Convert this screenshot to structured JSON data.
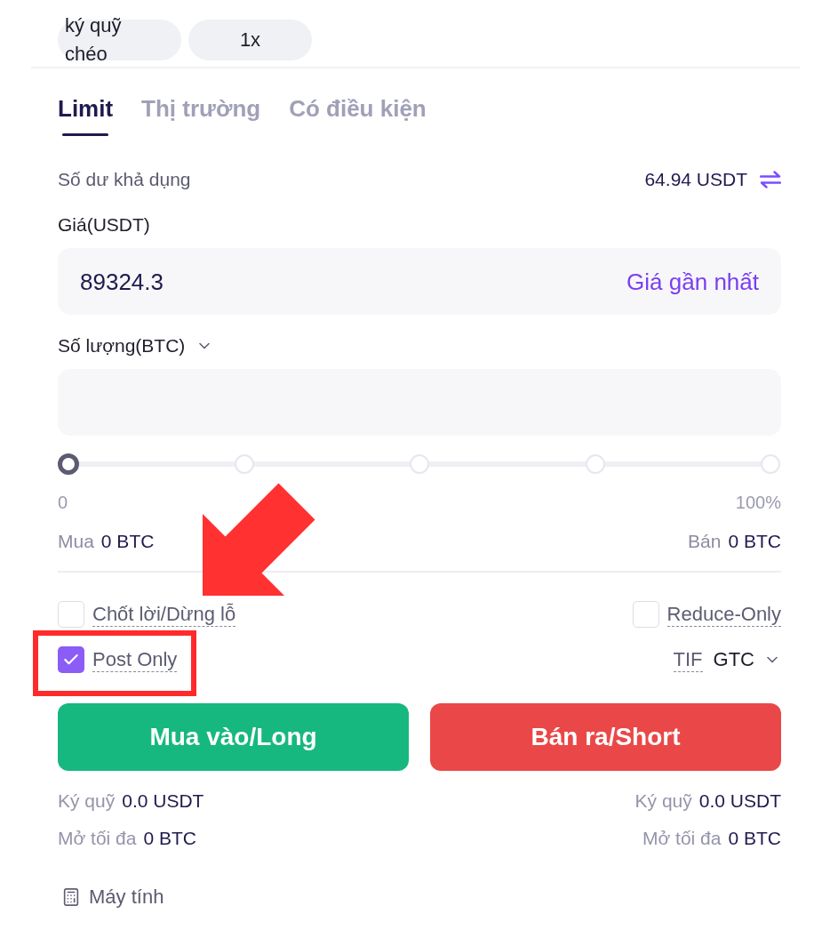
{
  "margin_controls": [
    {
      "kind": "margin_mode",
      "label": "ký quỹ chéo"
    },
    {
      "kind": "leverage",
      "label": "1x"
    }
  ],
  "order_tabs": [
    {
      "label": "Limit",
      "selected": true
    },
    {
      "label": "Thị trường",
      "selected": false
    },
    {
      "label": "Có điều kiện",
      "selected": false
    }
  ],
  "balance": {
    "label": "Số dư khả dụng",
    "value": "64.94 USDT"
  },
  "price": {
    "label": "Giá(USDT)",
    "value": "89324.3",
    "action": "Giá gần nhất"
  },
  "quantity": {
    "label": "Số lượng(BTC)"
  },
  "slider": {
    "level": 0,
    "min_label": "0",
    "max_label": "100%"
  },
  "trade_amounts": [
    {
      "label": "Mua",
      "value": "0 BTC"
    },
    {
      "label": "Bán",
      "value": "0 BTC"
    }
  ],
  "options": [
    {
      "kind": "checkbox",
      "label": "Chốt lời/Dừng lỗ",
      "checked": false
    },
    {
      "kind": "checkbox",
      "label": "Reduce-Only",
      "checked": false
    },
    {
      "kind": "checkbox",
      "label": "Post Only",
      "checked": true
    },
    {
      "kind": "select",
      "label": "TIF",
      "value": "GTC"
    }
  ],
  "actions": [
    {
      "kind": "buy",
      "label": "Mua vào/Long"
    },
    {
      "kind": "sell",
      "label": "Bán ra/Short"
    }
  ],
  "summary": [
    {
      "rows": [
        {
          "label": "Ký quỹ",
          "value": "0.0 USDT"
        },
        {
          "label": "Mở tối đa",
          "value": "0 BTC"
        }
      ]
    },
    {
      "rows": [
        {
          "label": "Ký quỹ",
          "value": "0.0 USDT"
        },
        {
          "label": "Mở tối đa",
          "value": "0 BTC"
        }
      ]
    }
  ],
  "calculator": {
    "label": "Máy tính"
  }
}
